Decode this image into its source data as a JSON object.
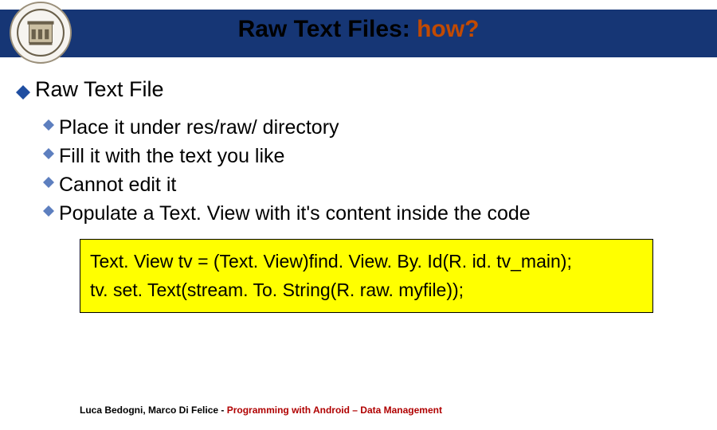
{
  "header": {
    "title_prefix": "Raw Text Files: ",
    "title_accent": "how?"
  },
  "main": {
    "heading": "Raw Text File",
    "items": [
      "Place it under res/raw/ directory",
      "Fill it with the text you like",
      "Cannot edit it",
      "Populate a Text. View with it's content inside the code"
    ]
  },
  "code": {
    "line1": "Text. View tv = (Text. View)find. View. By. Id(R. id. tv_main);",
    "line2": "tv. set. Text(stream. To. String(R. raw. myfile));"
  },
  "footer": {
    "authors": "Luca Bedogni, Marco Di Felice",
    "separator": " - ",
    "subtitle": "Programming with Android – Data Management"
  }
}
